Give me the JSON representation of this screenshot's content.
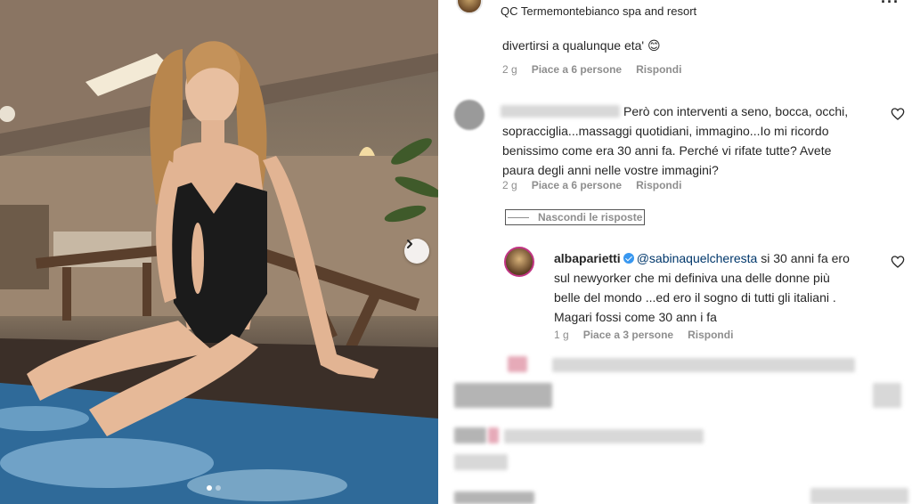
{
  "post": {
    "location": "QC Termemontebianco spa and resort",
    "carousel_total": 2,
    "carousel_active": 1
  },
  "comments": [
    {
      "text": "divertirsi a qualunque eta' 😊",
      "time": "2 g",
      "likes": "Piace a 6 persone",
      "reply": "Rispondi"
    },
    {
      "text_lines": [
        "Però con interventi a seno, bocca, occhi,",
        "sopracciglia...massaggi quotidiani, immagino...Io mi ricordo",
        "benissimo come era 30 anni fa. Perché vi rifate tutte? Avete",
        "paura degli anni nelle vostre immagini?"
      ],
      "time": "2 g",
      "likes": "Piace a 6 persone",
      "reply": "Rispondi",
      "hide_replies": "Nascondi le risposte"
    }
  ],
  "reply": {
    "username": "albaparietti",
    "mention": "@sabinaquelcheresta",
    "first_line_rest": "si 30 anni fa ero",
    "lines": [
      "sul newyorker che mi definiva una delle donne più",
      "belle del mondo ...ed ero il sogno di tutti gli italiani .",
      "Magari fossi come 30 ann i fa"
    ],
    "time": "1 g",
    "likes": "Piace a 3 persone",
    "reply": "Rispondi"
  },
  "colors": {
    "text": "#262626",
    "secondary": "#8e8e8e",
    "mention": "#00376b",
    "verified": "#3897f0"
  }
}
